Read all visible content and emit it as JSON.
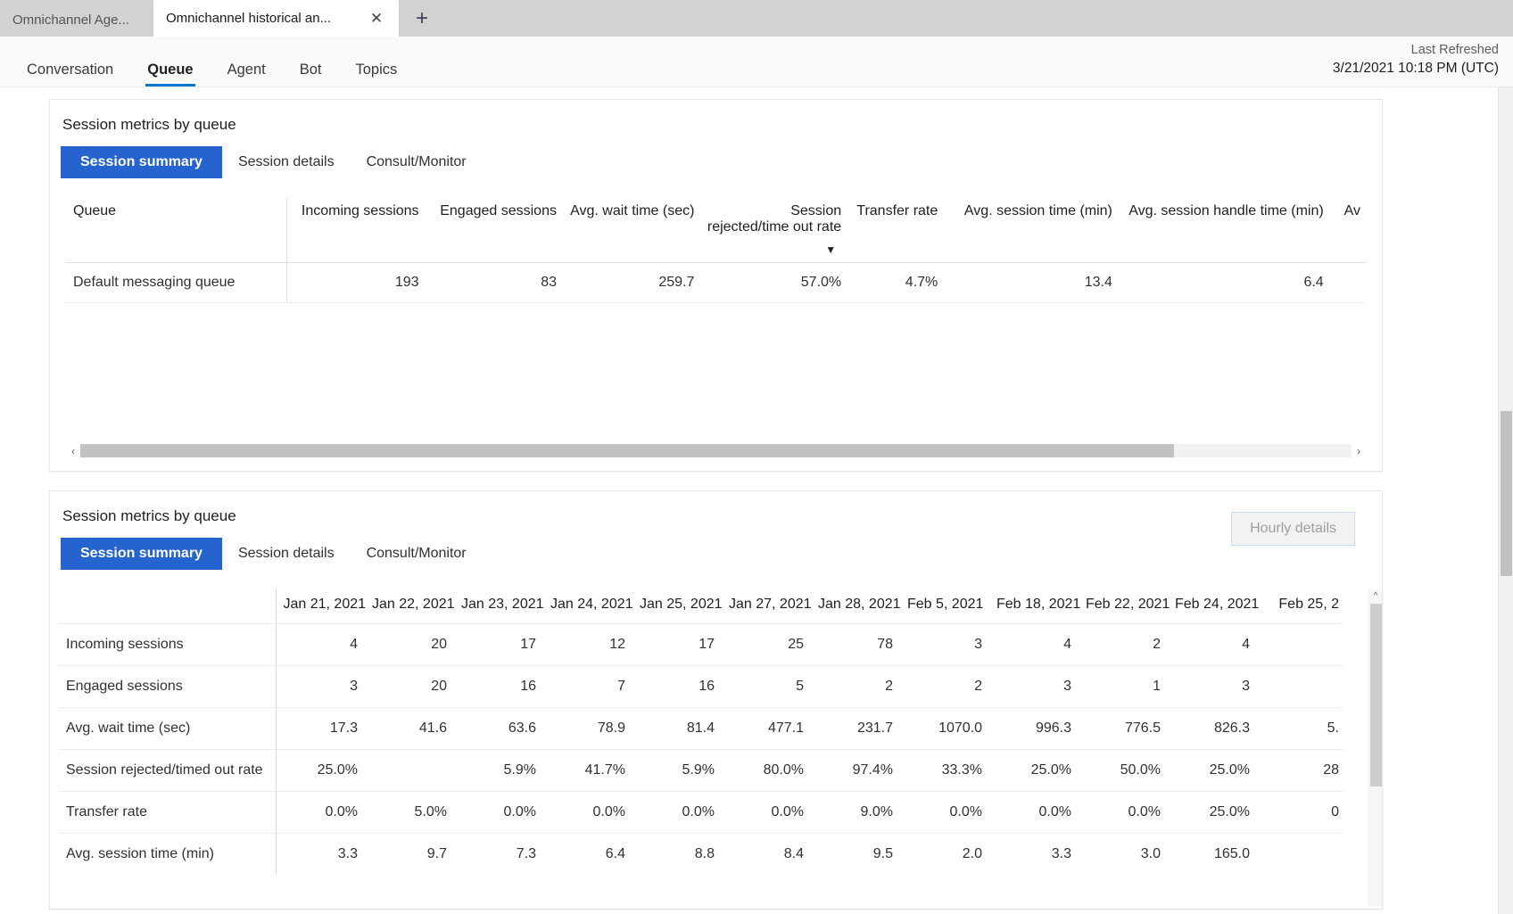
{
  "browser": {
    "tabs": [
      {
        "title": "Omnichannel Age...",
        "active": false
      },
      {
        "title": "Omnichannel historical an...",
        "active": true
      }
    ],
    "close_icon": "✕",
    "new_tab_icon": "+"
  },
  "appbar": {
    "nav": [
      {
        "label": "Conversation",
        "selected": false
      },
      {
        "label": "Queue",
        "selected": true
      },
      {
        "label": "Agent",
        "selected": false
      },
      {
        "label": "Bot",
        "selected": false
      },
      {
        "label": "Topics",
        "selected": false
      }
    ],
    "refresh_label": "Last Refreshed",
    "refresh_value": "3/21/2021 10:18 PM (UTC)"
  },
  "card1": {
    "title": "Session metrics by queue",
    "pivots": [
      {
        "label": "Session summary",
        "active": true
      },
      {
        "label": "Session details",
        "active": false
      },
      {
        "label": "Consult/Monitor",
        "active": false
      }
    ],
    "scroll_left_icon": "‹",
    "scroll_right_icon": "›",
    "sort_caret": "▼",
    "table": {
      "columns": [
        "Queue",
        "Incoming sessions",
        "Engaged sessions",
        "Avg. wait time (sec)",
        "Session rejected/time out rate",
        "Transfer rate",
        "Avg. session time (min)",
        "Avg. session handle time (min)",
        "Av"
      ],
      "sorted_column_index": 4,
      "rows": [
        [
          "Default messaging queue",
          "193",
          "83",
          "259.7",
          "57.0%",
          "4.7%",
          "13.4",
          "6.4",
          ""
        ]
      ]
    }
  },
  "card2": {
    "title": "Session metrics by queue",
    "pivots": [
      {
        "label": "Session summary",
        "active": true
      },
      {
        "label": "Session details",
        "active": false
      },
      {
        "label": "Consult/Monitor",
        "active": false
      }
    ],
    "hourly_button": "Hourly details",
    "scroll_up_icon": "^"
  },
  "chart_data": {
    "type": "table",
    "title": "Session metrics by queue",
    "categories": [
      "Jan 21, 2021",
      "Jan 22, 2021",
      "Jan 23, 2021",
      "Jan 24, 2021",
      "Jan 25, 2021",
      "Jan 27, 2021",
      "Jan 28, 2021",
      "Feb 5, 2021",
      "Feb 18, 2021",
      "Feb 22, 2021",
      "Feb 24, 2021",
      "Feb 25, 2"
    ],
    "series": [
      {
        "name": "Incoming sessions",
        "values": [
          "4",
          "20",
          "17",
          "12",
          "17",
          "25",
          "78",
          "3",
          "4",
          "2",
          "4",
          ""
        ]
      },
      {
        "name": "Engaged sessions",
        "values": [
          "3",
          "20",
          "16",
          "7",
          "16",
          "5",
          "2",
          "2",
          "3",
          "1",
          "3",
          ""
        ]
      },
      {
        "name": "Avg. wait time (sec)",
        "values": [
          "17.3",
          "41.6",
          "63.6",
          "78.9",
          "81.4",
          "477.1",
          "231.7",
          "1070.0",
          "996.3",
          "776.5",
          "826.3",
          "5."
        ]
      },
      {
        "name": "Session rejected/timed out rate",
        "values": [
          "25.0%",
          "",
          "5.9%",
          "41.7%",
          "5.9%",
          "80.0%",
          "97.4%",
          "33.3%",
          "25.0%",
          "50.0%",
          "25.0%",
          "28"
        ]
      },
      {
        "name": "Transfer rate",
        "values": [
          "0.0%",
          "5.0%",
          "0.0%",
          "0.0%",
          "0.0%",
          "0.0%",
          "9.0%",
          "0.0%",
          "0.0%",
          "0.0%",
          "25.0%",
          "0"
        ]
      },
      {
        "name": "Avg. session time (min)",
        "values": [
          "3.3",
          "9.7",
          "7.3",
          "6.4",
          "8.8",
          "8.4",
          "9.5",
          "2.0",
          "3.3",
          "3.0",
          "165.0",
          ""
        ]
      }
    ]
  },
  "colors": {
    "accent": "#2564cf",
    "tab_underline": "#0078d4",
    "card_border": "#e6e6e6"
  }
}
